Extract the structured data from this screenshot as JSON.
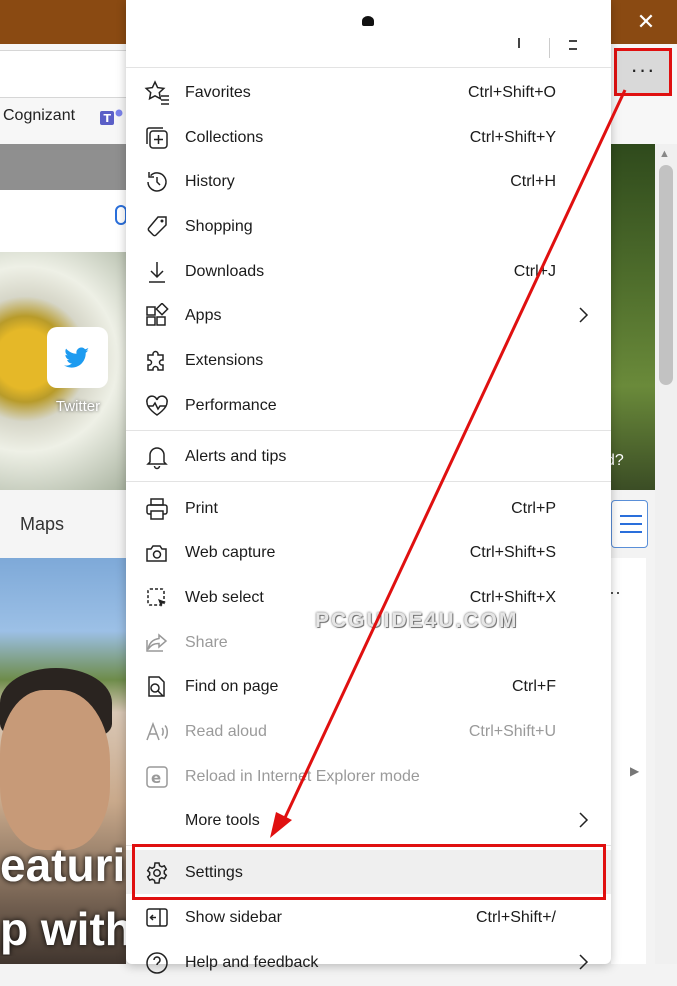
{
  "browser": {
    "close_icon": "close-icon",
    "more_button": "···",
    "favorites_bar": {
      "item_cognizant": "Cognizant"
    },
    "tiles": {
      "twitter": "Twitter"
    },
    "nav": {
      "maps": "Maps"
    },
    "news": {
      "headline_line1": "eaturi",
      "headline_line2": "p with"
    },
    "right_peek_text": "d?",
    "right_dots": "··"
  },
  "menu": {
    "items": [
      {
        "label": "Favorites",
        "shortcut": "Ctrl+Shift+O",
        "icon": "favorites-star-icon"
      },
      {
        "label": "Collections",
        "shortcut": "Ctrl+Shift+Y",
        "icon": "collections-icon"
      },
      {
        "label": "History",
        "shortcut": "Ctrl+H",
        "icon": "history-icon"
      },
      {
        "label": "Shopping",
        "shortcut": "",
        "icon": "tag-icon"
      },
      {
        "label": "Downloads",
        "shortcut": "Ctrl+J",
        "icon": "download-icon"
      },
      {
        "label": "Apps",
        "shortcut": "",
        "icon": "apps-icon"
      },
      {
        "label": "Extensions",
        "shortcut": "",
        "icon": "puzzle-icon"
      },
      {
        "label": "Performance",
        "shortcut": "",
        "icon": "heartbeat-icon"
      },
      {
        "label": "Alerts and tips",
        "shortcut": "",
        "icon": "bell-icon"
      },
      {
        "label": "Print",
        "shortcut": "Ctrl+P",
        "icon": "printer-icon"
      },
      {
        "label": "Web capture",
        "shortcut": "Ctrl+Shift+S",
        "icon": "camera-icon"
      },
      {
        "label": "Web select",
        "shortcut": "Ctrl+Shift+X",
        "icon": "select-icon"
      },
      {
        "label": "Share",
        "shortcut": "",
        "icon": "share-icon"
      },
      {
        "label": "Find on page",
        "shortcut": "Ctrl+F",
        "icon": "find-icon"
      },
      {
        "label": "Read aloud",
        "shortcut": "Ctrl+Shift+U",
        "icon": "read-aloud-icon"
      },
      {
        "label": "Reload in Internet Explorer mode",
        "shortcut": "",
        "icon": "ie-icon"
      },
      {
        "label": "More tools",
        "shortcut": "",
        "icon": ""
      },
      {
        "label": "Settings",
        "shortcut": "",
        "icon": "gear-icon"
      },
      {
        "label": "Show sidebar",
        "shortcut": "Ctrl+Shift+/",
        "icon": "sidebar-icon"
      },
      {
        "label": "Help and feedback",
        "shortcut": "",
        "icon": "help-icon"
      }
    ]
  },
  "watermark": "PCGUIDE4U.COM",
  "colors": {
    "highlight_red": "#e01010",
    "titlebar": "#8a4a12"
  }
}
